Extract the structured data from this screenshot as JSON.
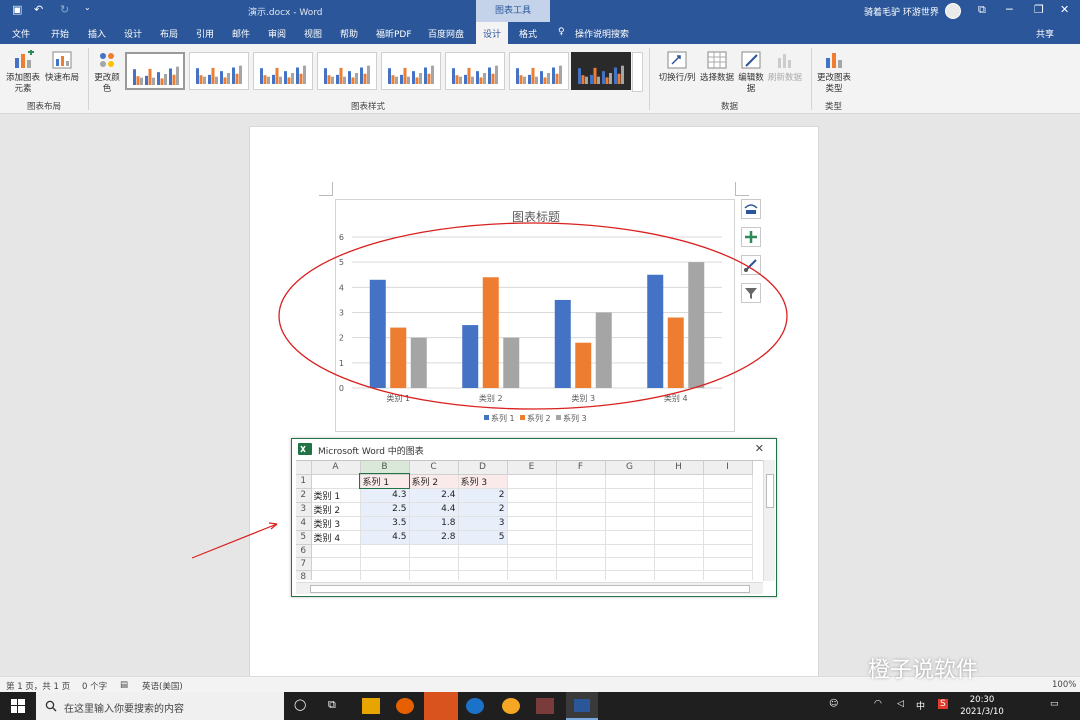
{
  "titlebar": {
    "doc_title": "演示.docx  -  Word",
    "chart_tools": "图表工具",
    "user": "骑着毛驴 环游世界",
    "share": "共享"
  },
  "tabs": [
    "文件",
    "开始",
    "插入",
    "设计",
    "布局",
    "引用",
    "邮件",
    "审阅",
    "视图",
    "帮助",
    "福昕PDF",
    "百度网盘",
    "设计",
    "格式"
  ],
  "tell_me": "操作说明搜索",
  "ribbon": {
    "add_element": "添加图表元素",
    "quick_layout": "快速布局",
    "change_color": "更改颜色",
    "switch_rowcol": "切换行/列",
    "select_data": "选择数据",
    "edit_data": "编辑数据",
    "refresh_data": "刷新数据",
    "change_type": "更改图表类型",
    "group_layout": "图表布局",
    "group_styles": "图表样式",
    "group_data": "数据",
    "group_type": "类型"
  },
  "chart_data": {
    "type": "bar",
    "title": "图表标题",
    "categories": [
      "类别 1",
      "类别 2",
      "类别 3",
      "类别 4"
    ],
    "series": [
      {
        "name": "系列 1",
        "values": [
          4.3,
          2.5,
          3.5,
          4.5
        ],
        "color": "#4472c4"
      },
      {
        "name": "系列 2",
        "values": [
          2.4,
          4.4,
          1.8,
          2.8
        ],
        "color": "#ed7d31"
      },
      {
        "name": "系列 3",
        "values": [
          2,
          2,
          3,
          5
        ],
        "color": "#a5a5a5"
      }
    ],
    "ylim": [
      0,
      6
    ],
    "yticks": [
      0,
      1,
      2,
      3,
      4,
      5,
      6
    ],
    "grid": true,
    "legend": "bottom"
  },
  "embed": {
    "title": "Microsoft Word 中的图表",
    "columns": [
      "A",
      "B",
      "C",
      "D",
      "E",
      "F",
      "G",
      "H",
      "I"
    ],
    "rows": [
      [
        "",
        "系列 1",
        "系列 2",
        "系列 3",
        "",
        "",
        "",
        "",
        ""
      ],
      [
        "类别 1",
        "4.3",
        "2.4",
        "2",
        "",
        "",
        "",
        "",
        ""
      ],
      [
        "类别 2",
        "2.5",
        "4.4",
        "2",
        "",
        "",
        "",
        "",
        ""
      ],
      [
        "类别 3",
        "3.5",
        "1.8",
        "3",
        "",
        "",
        "",
        "",
        ""
      ],
      [
        "类别 4",
        "4.5",
        "2.8",
        "5",
        "",
        "",
        "",
        "",
        ""
      ],
      [
        "",
        "",
        "",
        "",
        "",
        "",
        "",
        "",
        ""
      ],
      [
        "",
        "",
        "",
        "",
        "",
        "",
        "",
        "",
        ""
      ],
      [
        "",
        "",
        "",
        "",
        "",
        "",
        "",
        "",
        ""
      ]
    ]
  },
  "status": {
    "page": "第 1 页，共 1 页",
    "words": "0 个字",
    "language": "英语(美国)",
    "zoom": "100%"
  },
  "taskbar": {
    "search_placeholder": "在这里输入你要搜索的内容",
    "time": "20:30",
    "date": "2021/3/10",
    "ime": "中"
  },
  "watermark": "橙子说软件"
}
